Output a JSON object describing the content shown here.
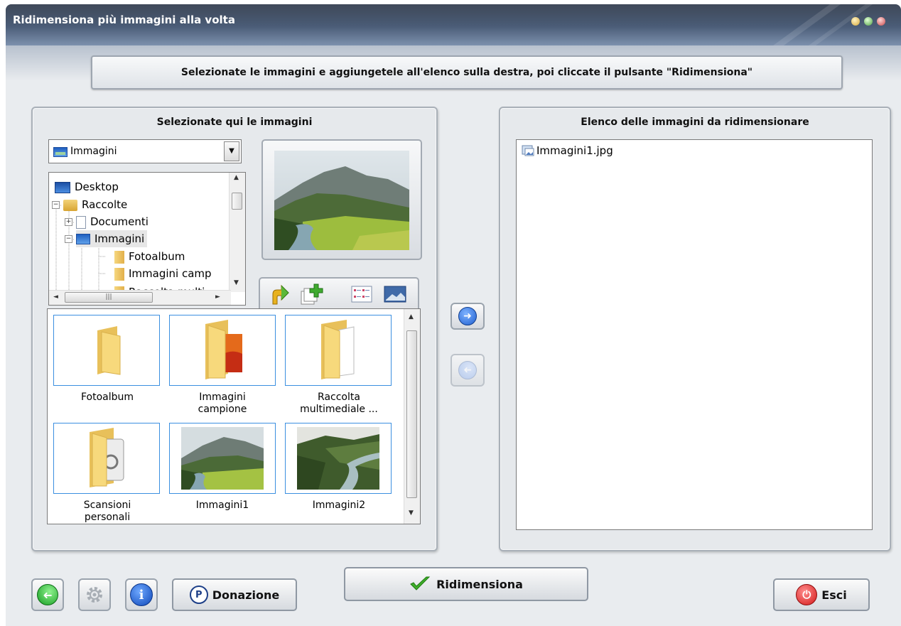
{
  "window": {
    "title": "Ridimensiona più immagini alla volta",
    "instruction": "Selezionate le immagini e aggiungetele all'elenco sulla destra, poi cliccate il pulsante \"Ridimensiona\""
  },
  "left_panel": {
    "title": "Selezionate qui le immagini",
    "folder_combo": {
      "value": "Immagini"
    },
    "tree": [
      {
        "label": "Desktop",
        "icon": "desktop-icon"
      },
      {
        "label": "Raccolte",
        "icon": "libraries-icon",
        "expanded": true
      },
      {
        "label": "Documenti",
        "icon": "documents-icon",
        "expanded": false
      },
      {
        "label": "Immagini",
        "icon": "pictures-icon",
        "expanded": true,
        "selected": true
      },
      {
        "label": "Fotoalbum",
        "icon": "folder-icon"
      },
      {
        "label": "Immagini camp",
        "icon": "folder-icon"
      },
      {
        "label": "Raccolta multi",
        "icon": "folder-icon"
      }
    ],
    "grid_items": [
      {
        "line1": "Fotoalbum",
        "line2": "",
        "icon": "folder-icon"
      },
      {
        "line1": "Immagini",
        "line2": "campione",
        "icon": "folder-pictures-icon"
      },
      {
        "line1": "Raccolta",
        "line2": "multimediale ...",
        "icon": "folder-documents-icon"
      },
      {
        "line1": "Scansioni",
        "line2": "personali",
        "icon": "folder-scans-icon"
      },
      {
        "line1": "Immagini1",
        "line2": "",
        "icon": "image-thumbnail"
      },
      {
        "line1": "Immagini2",
        "line2": "",
        "icon": "image-thumbnail"
      }
    ]
  },
  "right_panel": {
    "title": "Elenco delle immagini da ridimensionare",
    "items": [
      {
        "label": "Immagini1.jpg",
        "icon": "image-file-icon"
      }
    ]
  },
  "buttons": {
    "donate": "Donazione",
    "resize": "Ridimensiona",
    "exit": "Esci"
  },
  "colors": {
    "accent_blue": "#2d6fd8",
    "back_green": "#1e9e2a",
    "exit_red": "#d81e1e",
    "selection_border": "#3b8fe0"
  }
}
